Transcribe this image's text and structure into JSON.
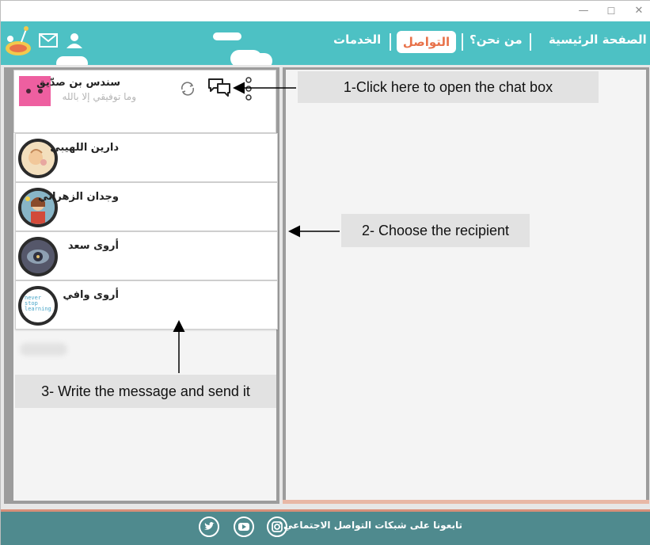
{
  "window": {
    "minimize_glyph": "—",
    "maximize_glyph": "☐",
    "close_glyph": "✕"
  },
  "header": {
    "nav": {
      "home": "الصفحة الرئيسية",
      "about": "من نحن؟",
      "communication": "التواصل",
      "services": "الخدمات"
    },
    "icons": [
      "logo",
      "mail-icon",
      "user-icon"
    ]
  },
  "current_user": {
    "name": "سندس بن صدّيق",
    "status": "وما توفيقي إلا بالله"
  },
  "contacts": [
    {
      "name": "دارين اللهيبي",
      "avatar": "cartoon-avatar"
    },
    {
      "name": "وجدان الزهراني",
      "avatar": "colorful-avatar"
    },
    {
      "name": "أروى سعد",
      "avatar": "eye-avatar"
    },
    {
      "name": "أروى وافي",
      "avatar": "text-avatar",
      "avatar_text": [
        "never",
        "stop",
        "learning"
      ]
    }
  ],
  "footer": {
    "text": "تابعونا على شبكات التواصل الاجتماعي",
    "icons": [
      "instagram-icon",
      "youtube-icon",
      "twitter-icon"
    ]
  },
  "annotations": {
    "step1": "1-Click here to open the chat box",
    "step2": "2- Choose the recipient",
    "step3": "3- Write the message and send it"
  },
  "colors": {
    "header": "#4dc1c4",
    "footer": "#4f8a8e",
    "active_nav_text": "#e8724a",
    "panel_border": "#9c9c9c"
  }
}
